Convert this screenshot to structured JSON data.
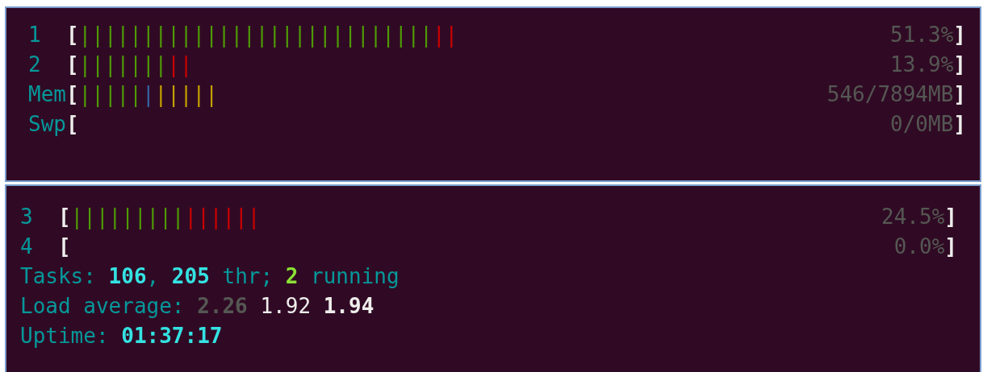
{
  "panels": [
    {
      "meters": [
        {
          "label": "1",
          "open": "[",
          "segments": [
            {
              "text": "||||||||||||||||||||||||||||",
              "color": "#4e9a06"
            },
            {
              "text": "||",
              "color": "#cc0000"
            }
          ],
          "value": "51.3%",
          "close": "]"
        },
        {
          "label": "2",
          "open": "[",
          "segments": [
            {
              "text": "|||||||",
              "color": "#4e9a06"
            },
            {
              "text": "||",
              "color": "#cc0000"
            }
          ],
          "value": "13.9%",
          "close": "]"
        },
        {
          "label": "Mem",
          "open": "[",
          "segments": [
            {
              "text": "|||||",
              "color": "#4e9a06"
            },
            {
              "text": "|",
              "color": "#3465a4"
            },
            {
              "text": "|||||",
              "color": "#c4a000"
            }
          ],
          "value": "546/7894MB",
          "close": "]"
        },
        {
          "label": "Swp",
          "open": "[",
          "value": "0/0MB",
          "close": "]"
        }
      ]
    },
    {
      "meters": [
        {
          "label": "3",
          "open": "[",
          "segments": [
            {
              "text": "|||||||||",
              "color": "#4e9a06"
            },
            {
              "text": "||||||",
              "color": "#cc0000"
            }
          ],
          "value": "24.5%",
          "close": "]"
        },
        {
          "label": "4",
          "open": "[",
          "value": "0.0%",
          "close": "]"
        }
      ],
      "lines": [
        [
          {
            "text": "Tasks: ",
            "kind": "label"
          },
          {
            "text": "106",
            "kind": "count"
          },
          {
            "text": ", ",
            "kind": "label"
          },
          {
            "text": "205",
            "kind": "count"
          },
          {
            "text": " thr; ",
            "kind": "label"
          },
          {
            "text": "2",
            "kind": "running"
          },
          {
            "text": " running",
            "kind": "label"
          }
        ],
        [
          {
            "text": "Load average: ",
            "kind": "label"
          },
          {
            "text": "2.26",
            "kind": "load1"
          },
          {
            "text": " 1.92",
            "kind": "load5"
          },
          {
            "text": " 1.94",
            "kind": "load15"
          }
        ],
        [
          {
            "text": "Uptime: ",
            "kind": "label"
          },
          {
            "text": "01:37:17",
            "kind": "count"
          }
        ]
      ]
    }
  ]
}
